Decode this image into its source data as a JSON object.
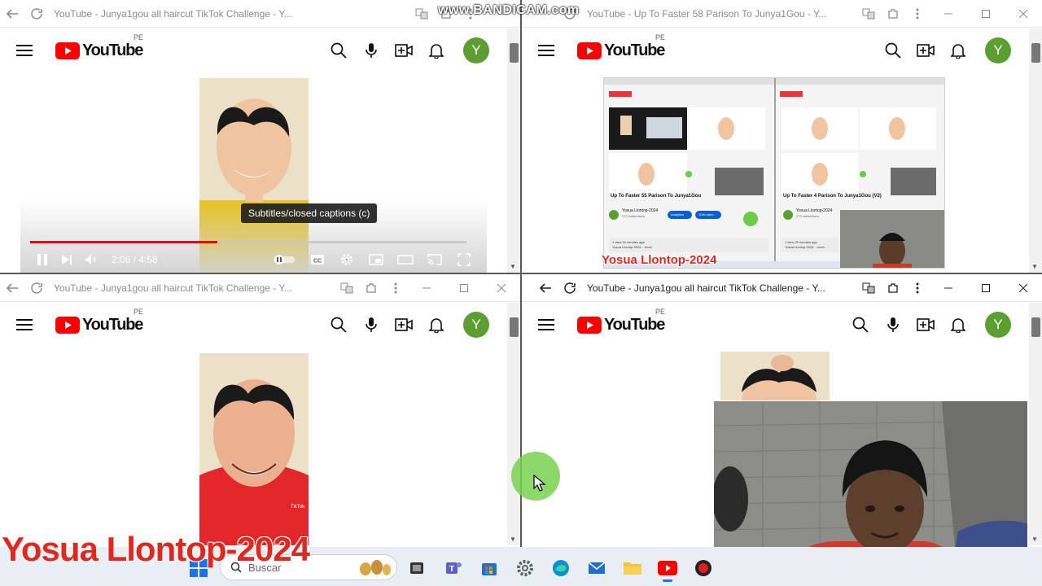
{
  "recorder": {
    "watermark": "www.BANDICAM.com"
  },
  "windows": [
    {
      "title": "YouTube - Junya1gou all haircut TikTok Challenge - Y..."
    },
    {
      "title": "YouTube - Up To Faster 58 Parison To Junya1Gou - Y..."
    },
    {
      "title": "YouTube - Junya1gou all haircut TikTok Challenge - Y..."
    },
    {
      "title": "YouTube - Junya1gou all haircut TikTok Challenge - Y..."
    }
  ],
  "youtube": {
    "logo": "YouTube",
    "country": "PE",
    "avatar": "Y"
  },
  "player": {
    "tooltip": "Subtitles/closed captions (c)",
    "time": "2:06 / 4:58",
    "progress": 0.43,
    "tiktok": "TikTok"
  },
  "nested": {
    "video1_title": "Up To Faster 55 Parison To Junya1Gou",
    "video2_title": "Up To Faster 4 Parison To Junya1Gou (V2)",
    "channel": "Yosua Llontop-2024",
    "subs": "272 subscribers",
    "analytics": "Analytics",
    "edit": "Edit video",
    "views1": "1 view  16 minutes ago",
    "views2": "1 view  25 minutes ago",
    "desc": "Yosua Llontop-2024 ...more"
  },
  "watermarks": {
    "nested": "Yosua Llontop-2024",
    "main": "Yosua Llontop-2024"
  },
  "taskbar": {
    "search_placeholder": "Buscar"
  },
  "colors": {
    "youtube_red": "#ff0000",
    "avatar_green": "#5c9e2f",
    "watermark_red": "#e0281e"
  }
}
